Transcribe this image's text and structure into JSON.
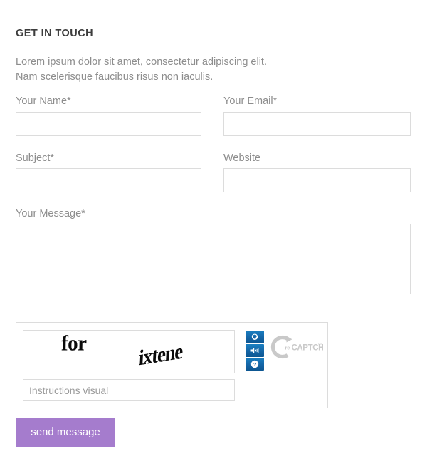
{
  "section": {
    "title": "GET IN TOUCH",
    "intro_line_1": "Lorem ipsum dolor sit amet, consectetur adipiscing elit.",
    "intro_line_2": "Nam scelerisque faucibus risus non iaculis."
  },
  "form": {
    "fields": [
      {
        "label": "Your Name",
        "required_marker": "*",
        "value": "",
        "placeholder": ""
      },
      {
        "label": "Your Email",
        "required_marker": "*",
        "value": "",
        "placeholder": ""
      },
      {
        "label": "Subject",
        "required_marker": "*",
        "value": "",
        "placeholder": ""
      },
      {
        "label": "Website",
        "required_marker": "",
        "value": "",
        "placeholder": ""
      },
      {
        "label": "Your Message",
        "required_marker": "*",
        "value": "",
        "placeholder": ""
      }
    ],
    "submit_label": "send message",
    "submit_color": "#a57ccd"
  },
  "captcha": {
    "type": "recaptcha",
    "word_1": "for",
    "word_2": "ixtene",
    "input_value": "",
    "input_placeholder": "Instructions visual",
    "brand_text": "reCAPTCHA",
    "brand_trademark": "™",
    "buttons": [
      {
        "name": "refresh",
        "title": "Get a new challenge"
      },
      {
        "name": "audio",
        "title": "Get an audio challenge"
      },
      {
        "name": "help",
        "title": "Help"
      }
    ],
    "button_color": "#1567a8",
    "logo_color": "#c9c9c9"
  },
  "colors": {
    "label": "#8d8d8d",
    "heading": "#3d3d3d",
    "border": "#dcdcdc"
  }
}
